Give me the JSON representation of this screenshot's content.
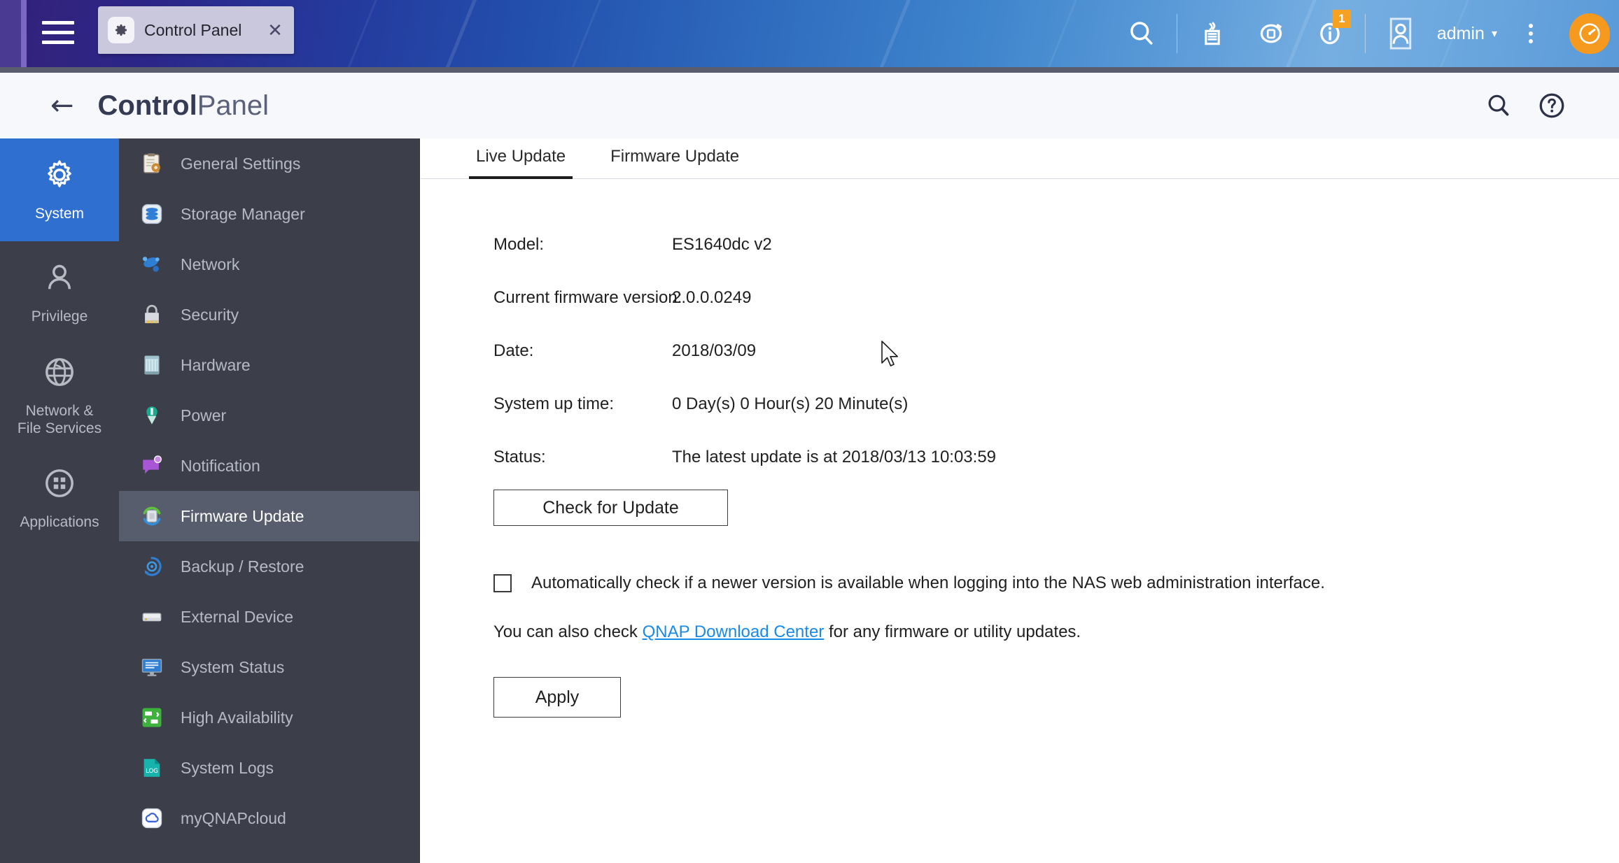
{
  "taskbar": {
    "menu_icon": "hamburger-icon",
    "app_tab": {
      "icon": "gear-icon",
      "label": "Control Panel",
      "close": "✕"
    },
    "icons": [
      {
        "name": "search-icon",
        "label": "Search"
      },
      {
        "name": "notes-icon",
        "label": "Notes"
      },
      {
        "name": "backup-sync-icon",
        "label": "Backup Station"
      },
      {
        "name": "info-icon",
        "label": "Information",
        "badge": "1"
      },
      {
        "name": "user-avatar-icon",
        "label": "User"
      }
    ],
    "user": "admin",
    "caret": "▾",
    "more_icon": "vertical-dots-icon",
    "dashboard_icon": "dashboard-gauge-icon"
  },
  "cp_header": {
    "back": "←",
    "title_bold": "Control",
    "title_light": "Panel",
    "search_icon": "search-icon",
    "help_icon": "help-circle-icon"
  },
  "rail": {
    "items": [
      {
        "label": "System",
        "icon": "gear-icon",
        "active": true
      },
      {
        "label": "Privilege",
        "icon": "user-icon",
        "active": false
      },
      {
        "label": "Network &\nFile Services",
        "icon": "globe-icon",
        "active": false
      },
      {
        "label": "Applications",
        "icon": "apps-grid-icon",
        "active": false
      }
    ]
  },
  "submenu": {
    "items": [
      {
        "label": "General Settings",
        "icon": "clipboard-gear-icon",
        "selected": false
      },
      {
        "label": "Storage Manager",
        "icon": "storage-disk-icon",
        "selected": false
      },
      {
        "label": "Network",
        "icon": "network-nodes-icon",
        "selected": false
      },
      {
        "label": "Security",
        "icon": "padlock-icon",
        "selected": false
      },
      {
        "label": "Hardware",
        "icon": "hardware-chassis-icon",
        "selected": false
      },
      {
        "label": "Power",
        "icon": "power-bulb-icon",
        "selected": false
      },
      {
        "label": "Notification",
        "icon": "notification-bubble-icon",
        "selected": false
      },
      {
        "label": "Firmware Update",
        "icon": "firmware-update-icon",
        "selected": true
      },
      {
        "label": "Backup / Restore",
        "icon": "backup-restore-icon",
        "selected": false
      },
      {
        "label": "External Device",
        "icon": "external-drive-icon",
        "selected": false
      },
      {
        "label": "System Status",
        "icon": "system-monitor-icon",
        "selected": false
      },
      {
        "label": "High Availability",
        "icon": "high-availability-icon",
        "selected": false
      },
      {
        "label": "System Logs",
        "icon": "system-logs-icon",
        "selected": false
      },
      {
        "label": "myQNAPcloud",
        "icon": "cloud-icon",
        "selected": false
      }
    ]
  },
  "main": {
    "tabs": [
      {
        "label": "Live Update",
        "active": true
      },
      {
        "label": "Firmware Update",
        "active": false
      }
    ],
    "fields": [
      {
        "label": "Model:",
        "value": "ES1640dc v2"
      },
      {
        "label": "Current firmware version:",
        "value": "2.0.0.0249"
      },
      {
        "label": "Date:",
        "value": "2018/03/09"
      },
      {
        "label": "System up time:",
        "value": "0 Day(s) 0 Hour(s) 20 Minute(s)"
      },
      {
        "label": "Status:",
        "value": "The latest update is at 2018/03/13 10:03:59"
      }
    ],
    "check_update_button": "Check for Update",
    "auto_check_label": "Automatically check if a newer version is available when logging into the NAS web administration interface.",
    "auto_check_checked": false,
    "link_prefix": "You can also check ",
    "link_text": "QNAP Download Center",
    "link_suffix": " for any firmware or utility updates.",
    "apply_button": "Apply"
  },
  "colors": {
    "accent_blue": "#2f6fd0",
    "link_blue": "#1a8ae5",
    "sidebar_bg": "#3c3f4a",
    "sidebar_selected": "#585d6e",
    "badge_orange": "#f5a122"
  }
}
